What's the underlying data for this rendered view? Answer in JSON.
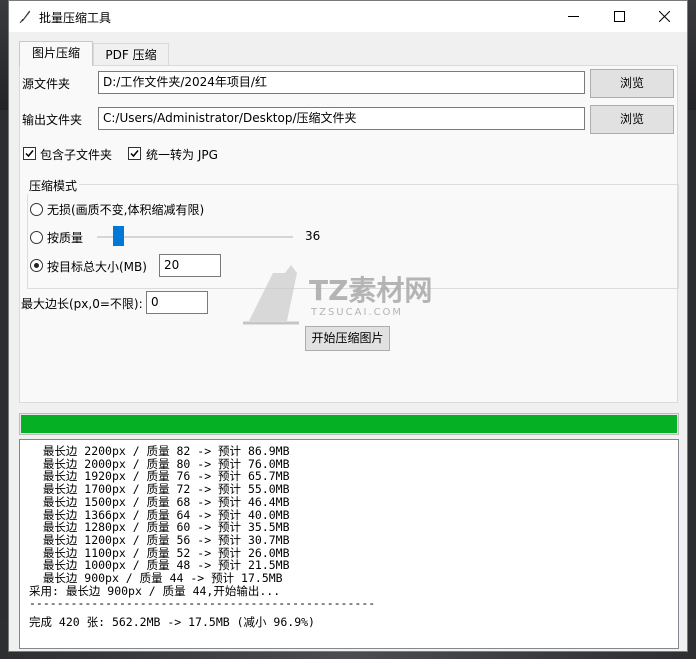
{
  "window": {
    "title": "批量压缩工具"
  },
  "tabs": [
    {
      "label": "图片压缩",
      "active": true
    },
    {
      "label": "PDF 压缩",
      "active": false
    }
  ],
  "form": {
    "source_label": "源文件夹",
    "source_value": "D:/工作文件夹/2024年项目/红",
    "output_label": "输出文件夹",
    "output_value": "C:/Users/Administrator/Desktop/压缩文件夹",
    "browse_label": "浏览",
    "include_subfolders_label": "包含子文件夹",
    "include_subfolders_checked": true,
    "convert_jpg_label": "统一转为 JPG",
    "convert_jpg_checked": true
  },
  "compress_mode": {
    "legend": "压缩模式",
    "options": [
      {
        "label": "无损(画质不变,体积缩减有限)",
        "selected": false
      },
      {
        "label": "按质量",
        "selected": false
      },
      {
        "label": "按目标总大小(MB)",
        "selected": true
      }
    ],
    "quality_value": "36",
    "target_size_value": "20"
  },
  "max_edge": {
    "label": "最大边长(px,0=不限):",
    "value": "0"
  },
  "start_button_label": "开始压缩图片",
  "progress": {
    "fraction": 1.0
  },
  "watermark": {
    "brand": "TZ素材网",
    "domain": "TZSUCAI.COM"
  },
  "log": {
    "lines": [
      "  最长边 2200px / 质量 82 -> 预计 86.9MB",
      "  最长边 2000px / 质量 80 -> 预计 76.0MB",
      "  最长边 1920px / 质量 76 -> 预计 65.7MB",
      "  最长边 1700px / 质量 72 -> 预计 55.0MB",
      "  最长边 1500px / 质量 68 -> 预计 46.4MB",
      "  最长边 1366px / 质量 64 -> 预计 40.0MB",
      "  最长边 1280px / 质量 60 -> 预计 35.5MB",
      "  最长边 1200px / 质量 56 -> 预计 30.7MB",
      "  最长边 1100px / 质量 52 -> 预计 26.0MB",
      "  最长边 1000px / 质量 48 -> 预计 21.5MB",
      "  最长边 900px / 质量 44 -> 预计 17.5MB",
      "采用: 最长边 900px / 质量 44,开始输出...",
      "--------------------------------------------------",
      "完成 420 张: 562.2MB -> 17.5MB (减小 96.9%)"
    ]
  },
  "colors": {
    "progress": "#06b025",
    "slider": "#0078d7"
  }
}
